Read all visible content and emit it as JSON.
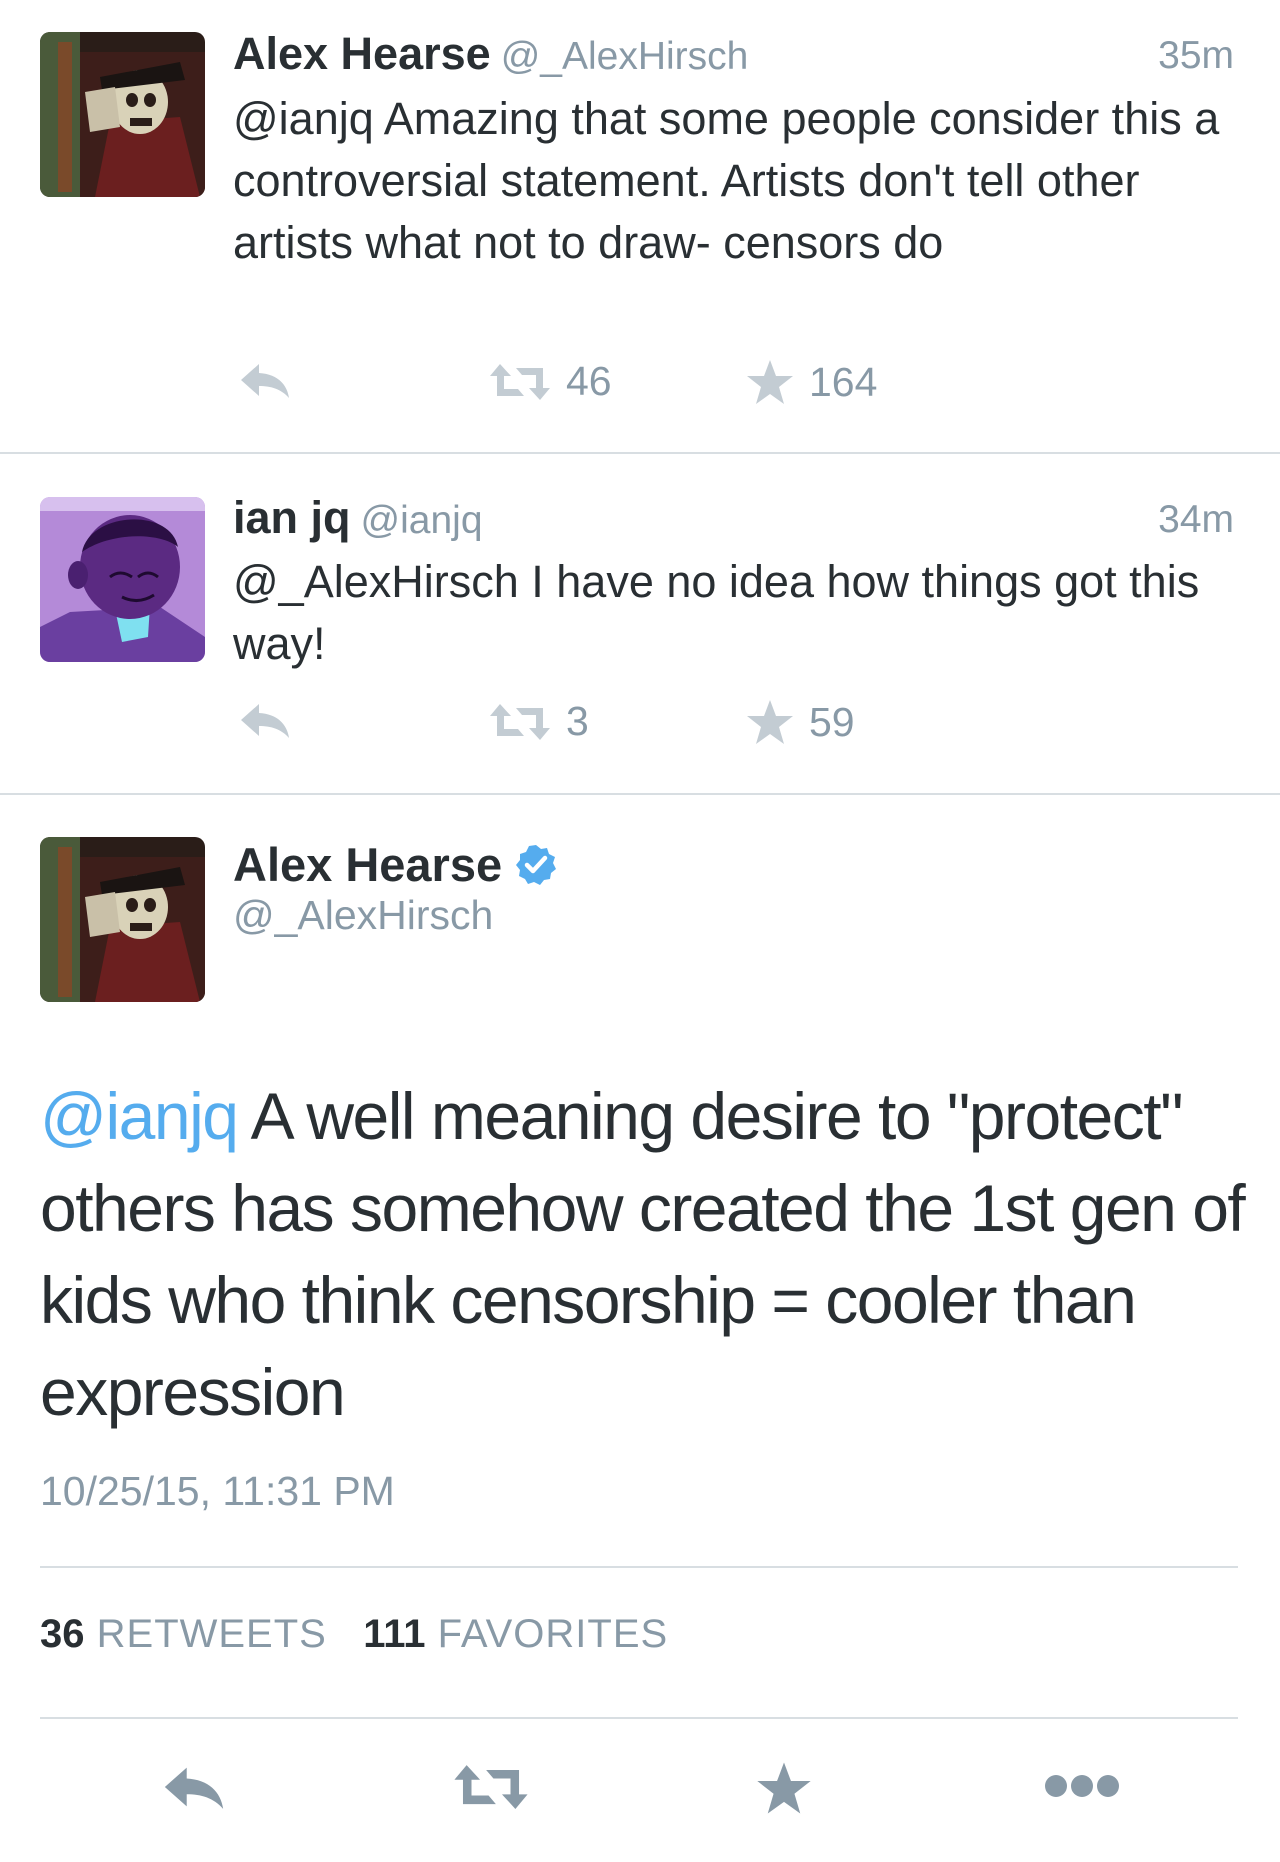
{
  "tweets": [
    {
      "name": "Alex Hearse",
      "handle": "@_AlexHirsch",
      "time": "35m",
      "text": "@ianjq Amazing that some people consider this a controversial statement. Artists don't tell other artists what not to draw- censors do",
      "retweets": "46",
      "favorites": "164",
      "avatar": "skeleton-avatar"
    },
    {
      "name": "ian jq",
      "handle": "@ianjq",
      "time": "34m",
      "text": "@_AlexHirsch I have no idea how things got this way!",
      "retweets": "3",
      "favorites": "59",
      "avatar": "purple-character-avatar"
    }
  ],
  "main_tweet": {
    "name": "Alex Hearse",
    "handle": "@_AlexHirsch",
    "verified_icon": "verified-badge-icon",
    "mention": "@ianjq",
    "text": " A well meaning desire to \"protect\" others has somehow created the 1st gen of kids who think censorship = cooler than expression",
    "timestamp": "10/25/15, 11:31 PM",
    "retweet_count": "36",
    "retweet_label": "RETWEETS",
    "favorite_count": "111",
    "favorite_label": "FAVORITES"
  },
  "colors": {
    "link": "#55acee",
    "text": "#292f33",
    "muted": "#8899a6",
    "icon": "#c3ccd3",
    "icon_dark": "#8899a6"
  },
  "icons": [
    "reply-icon",
    "retweet-icon",
    "favorite-star-icon",
    "more-dots-icon"
  ]
}
